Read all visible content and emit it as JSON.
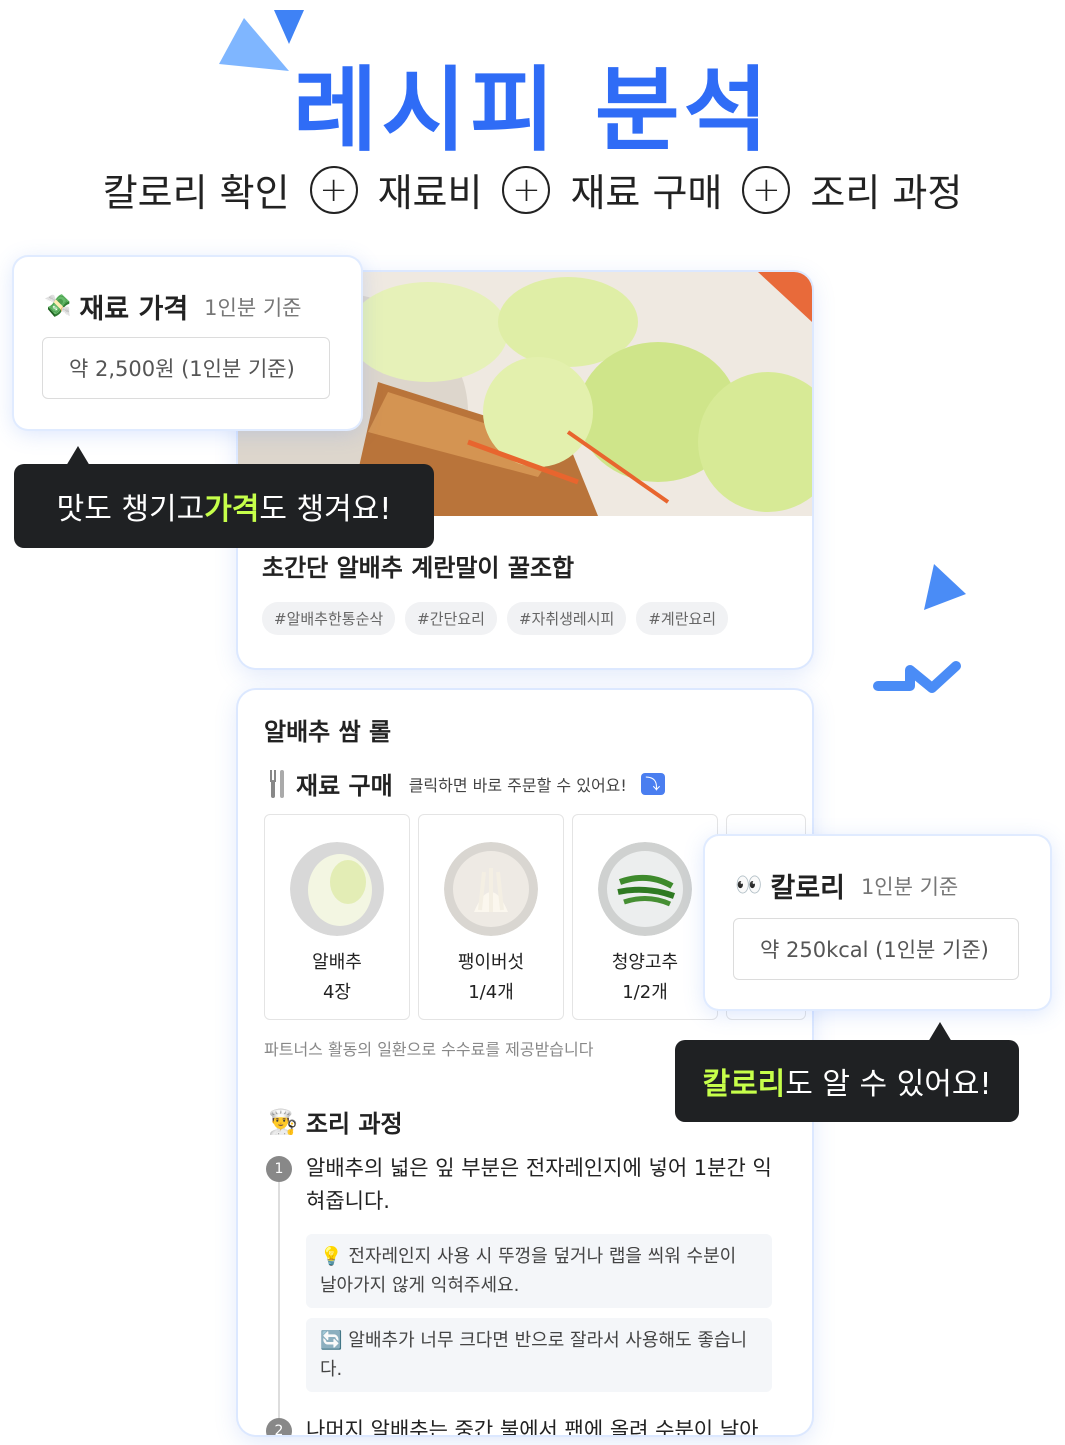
{
  "hero": {
    "title": "레시피 분석",
    "features": [
      "칼로리 확인",
      "재료비",
      "재료 구매",
      "조리 과정"
    ],
    "plus_symbol": "+"
  },
  "recipe": {
    "title": "초간단 알배추 계란말이 꿀조합",
    "tags": [
      "#알배추한통순삭",
      "#간단요리",
      "#자취생레시피",
      "#계란요리"
    ]
  },
  "detail": {
    "title": "알배추 쌈 롤",
    "purchase": {
      "heading": "재료 구매",
      "subtitle": "클릭하면 바로 주문할 수 있어요!",
      "arrow_icon": "⤵"
    },
    "ingredients": [
      {
        "name": "알배추",
        "qty": "4장"
      },
      {
        "name": "팽이버섯",
        "qty": "1/4개"
      },
      {
        "name": "청양고추",
        "qty": "1/2개"
      }
    ],
    "partners_note": "파트너스 활동의 일환으로 수수료를 제공받습니다",
    "cooking": {
      "heading": "조리 과정",
      "steps": [
        {
          "num": "1",
          "text": "알배추의 넓은 잎 부분은 전자레인지에 넣어 1분간 익혀줍니다."
        },
        {
          "num": "2",
          "text": "나머지 알배추는 중간 불에서 팬에 올려 수분이 날아"
        }
      ],
      "tips": [
        {
          "icon": "💡",
          "text": "전자레인지 사용 시 뚜껑을 덮거나 랩을 씌워 수분이 날아가지 않게 익혀주세요."
        },
        {
          "icon": "🔄",
          "text": "알배추가 너무 크다면 반으로 잘라서 사용해도 좋습니다."
        }
      ]
    }
  },
  "price_popup": {
    "icon": "💸",
    "heading": "재료 가격",
    "basis": "1인분 기준",
    "value": "약 2,500원 (1인분 기준)"
  },
  "price_bubble": {
    "pre": "맛도 챙기고 ",
    "highlight": "가격",
    "post": "도 챙겨요!"
  },
  "calorie_popup": {
    "icon": "👀",
    "heading": "칼로리",
    "basis": "1인분 기준",
    "value": "약 250kcal (1인분 기준)"
  },
  "calorie_bubble": {
    "highlight": "칼로리",
    "post": "도 알 수 있어요!"
  },
  "colors": {
    "accent": "#2f6cf6",
    "highlight": "#c6ff4a",
    "bubble_bg": "#1f2123"
  }
}
